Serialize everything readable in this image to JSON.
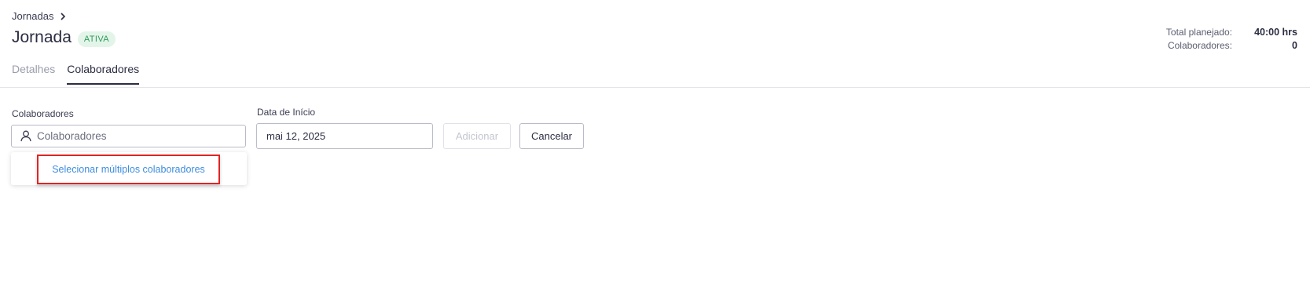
{
  "breadcrumb": {
    "parent": "Jornadas"
  },
  "header": {
    "title": "Jornada",
    "status_badge": "ATIVA"
  },
  "tabs": [
    {
      "label": "Detalhes",
      "active": false
    },
    {
      "label": "Colaboradores",
      "active": true
    }
  ],
  "stats": {
    "total_planned_label": "Total planejado:",
    "total_planned_value": "40:00 hrs",
    "collaborators_label": "Colaboradores:",
    "collaborators_value": "0"
  },
  "form": {
    "collaborators_label": "Colaboradores",
    "collaborators_placeholder": "Colaboradores",
    "start_date_label": "Data de Início",
    "start_date_value": "mai 12, 2025",
    "add_button": "Adicionar",
    "cancel_button": "Cancelar"
  },
  "dropdown": {
    "option": "Selecionar múltiplos colaboradores"
  },
  "colors": {
    "badge_bg": "#e3f5e9",
    "badge_text": "#2f9a5a",
    "link": "#3d8de0",
    "highlight": "#e02424"
  },
  "icons": {
    "breadcrumb": "chevron-right-icon",
    "search": "user-icon"
  }
}
